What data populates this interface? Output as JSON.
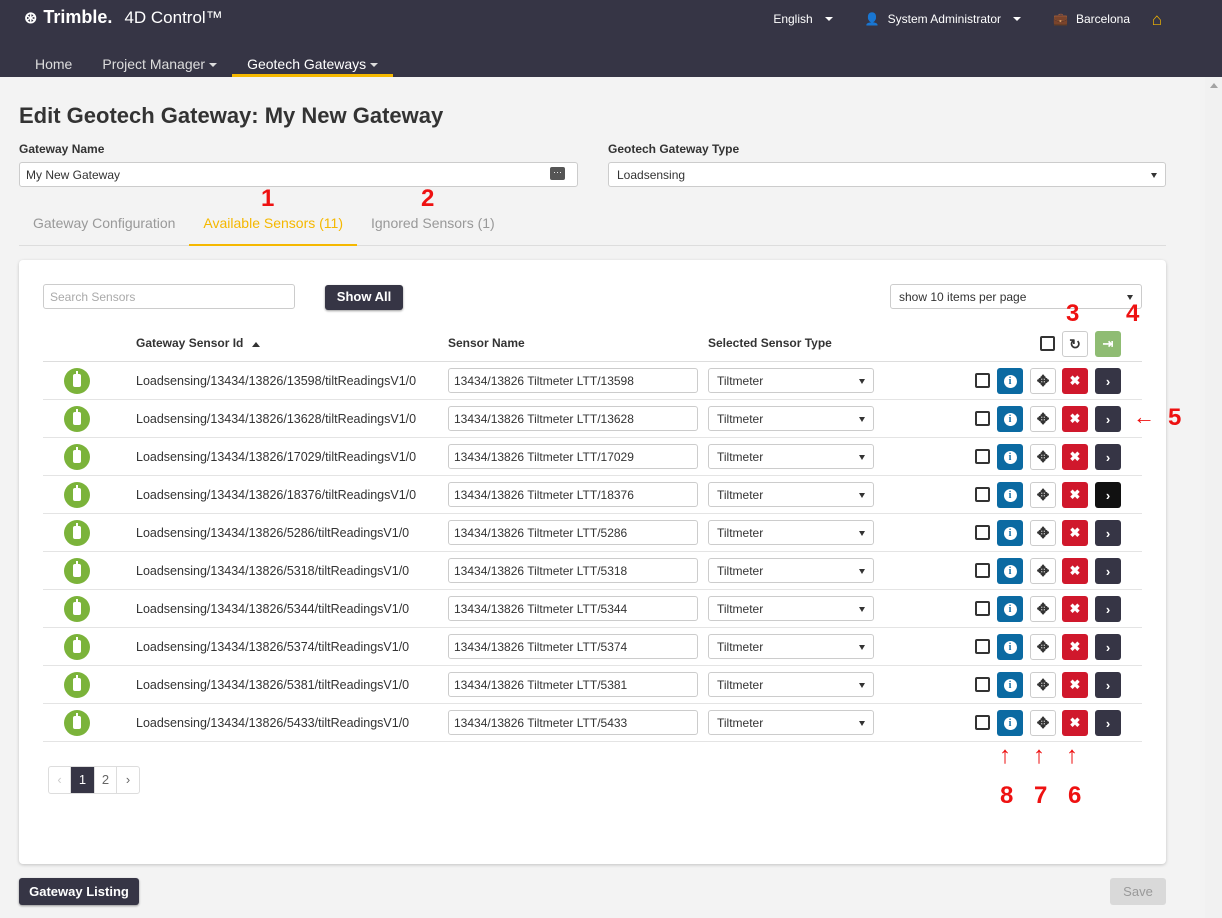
{
  "header": {
    "brand": "Trimble.",
    "app_name": "4D Control™",
    "language": "English",
    "user": "System Administrator",
    "site": "Barcelona"
  },
  "nav": {
    "tabs": [
      {
        "label": "Home"
      },
      {
        "label": "Project Manager"
      },
      {
        "label": "Geotech Gateways"
      }
    ]
  },
  "page": {
    "title": "Edit Geotech Gateway: My New Gateway",
    "gateway_name_label": "Gateway Name",
    "gateway_name_value": "My New Gateway",
    "gateway_type_label": "Geotech Gateway Type",
    "gateway_type_value": "Loadsensing",
    "tabs": [
      {
        "label": "Gateway Configuration"
      },
      {
        "label": "Available Sensors (11)"
      },
      {
        "label": "Ignored Sensors (1)"
      }
    ]
  },
  "annotations": {
    "n1": "1",
    "n2": "2",
    "n3": "3",
    "n4": "4",
    "n5": "5",
    "n6": "6",
    "n7": "7",
    "n8": "8"
  },
  "sensors": {
    "search_placeholder": "Search Sensors",
    "show_all_label": "Show All",
    "page_size": "show 10 items per page",
    "col_id": "Gateway Sensor Id",
    "col_name": "Sensor Name",
    "col_type": "Selected Sensor Type",
    "rows": [
      {
        "id": "Loadsensing/13434/13826/13598/tiltReadingsV1/0",
        "name": "13434/13826 Tiltmeter LTT/13598",
        "type": "Tiltmeter"
      },
      {
        "id": "Loadsensing/13434/13826/13628/tiltReadingsV1/0",
        "name": "13434/13826 Tiltmeter LTT/13628",
        "type": "Tiltmeter"
      },
      {
        "id": "Loadsensing/13434/13826/17029/tiltReadingsV1/0",
        "name": "13434/13826 Tiltmeter LTT/17029",
        "type": "Tiltmeter"
      },
      {
        "id": "Loadsensing/13434/13826/18376/tiltReadingsV1/0",
        "name": "13434/13826 Tiltmeter LTT/18376",
        "type": "Tiltmeter"
      },
      {
        "id": "Loadsensing/13434/13826/5286/tiltReadingsV1/0",
        "name": "13434/13826 Tiltmeter LTT/5286",
        "type": "Tiltmeter"
      },
      {
        "id": "Loadsensing/13434/13826/5318/tiltReadingsV1/0",
        "name": "13434/13826 Tiltmeter LTT/5318",
        "type": "Tiltmeter"
      },
      {
        "id": "Loadsensing/13434/13826/5344/tiltReadingsV1/0",
        "name": "13434/13826 Tiltmeter LTT/5344",
        "type": "Tiltmeter"
      },
      {
        "id": "Loadsensing/13434/13826/5374/tiltReadingsV1/0",
        "name": "13434/13826 Tiltmeter LTT/5374",
        "type": "Tiltmeter"
      },
      {
        "id": "Loadsensing/13434/13826/5381/tiltReadingsV1/0",
        "name": "13434/13826 Tiltmeter LTT/5381",
        "type": "Tiltmeter"
      },
      {
        "id": "Loadsensing/13434/13826/5433/tiltReadingsV1/0",
        "name": "13434/13826 Tiltmeter LTT/5433",
        "type": "Tiltmeter"
      }
    ],
    "pager": {
      "prev": "‹",
      "page1": "1",
      "page2": "2",
      "next": "›"
    }
  },
  "footer": {
    "listing_label": "Gateway Listing",
    "save_label": "Save"
  },
  "colors": {
    "accent": "#f5b800",
    "header_bg": "#363545",
    "info": "#0b6aa2",
    "delete": "#d0182c",
    "sensor_ok": "#7bb33a"
  }
}
